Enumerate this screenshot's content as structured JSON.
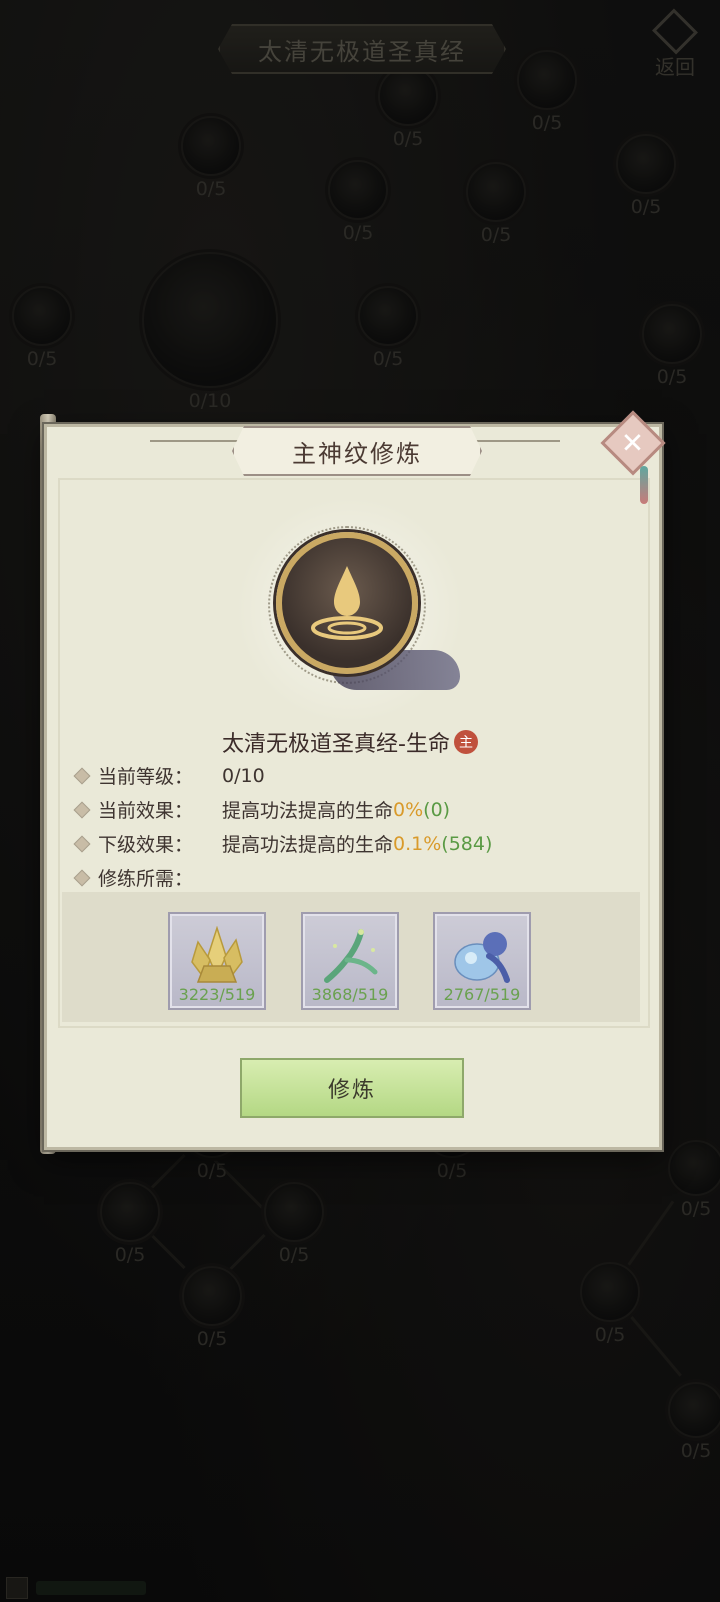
{
  "background": {
    "top_title": "太清无极道圣真经",
    "back_label": "返回",
    "nodes": [
      {
        "count": "0/5"
      },
      {
        "count": "0/5"
      },
      {
        "count": "0/5"
      },
      {
        "count": "0/5"
      },
      {
        "count": "0/5"
      },
      {
        "count": "0/5"
      },
      {
        "count": "0/5"
      },
      {
        "count": "0/10"
      },
      {
        "count": "0/5"
      },
      {
        "count": "0/5"
      },
      {
        "count": "0/5"
      },
      {
        "count": "0/5"
      },
      {
        "count": "0/5"
      },
      {
        "count": "0/5"
      },
      {
        "count": "0/5"
      },
      {
        "count": "0/5"
      },
      {
        "count": "0/5"
      },
      {
        "count": "0/5"
      }
    ]
  },
  "modal": {
    "title": "主神纹修炼",
    "close_icon": "close-icon",
    "skill_name": "太清无极道圣真经-生命",
    "main_badge": "主",
    "current_level_label": "当前等级：",
    "current_level_value": "0/10",
    "current_effect_label": "当前效果：",
    "current_effect_text": "提高功法提高的生命",
    "current_effect_percent": "0%",
    "current_effect_value": "(0)",
    "next_effect_label": "下级效果：",
    "next_effect_text": "提高功法提高的生命",
    "next_effect_percent": "0.1%",
    "next_effect_value": "(584)",
    "requirement_label": "修练所需：",
    "items": [
      {
        "name": "gold-crystal",
        "count": "3223/519"
      },
      {
        "name": "green-branch",
        "count": "3868/519"
      },
      {
        "name": "blue-spirit",
        "count": "2767/519"
      }
    ],
    "cultivate_button": "修炼"
  }
}
